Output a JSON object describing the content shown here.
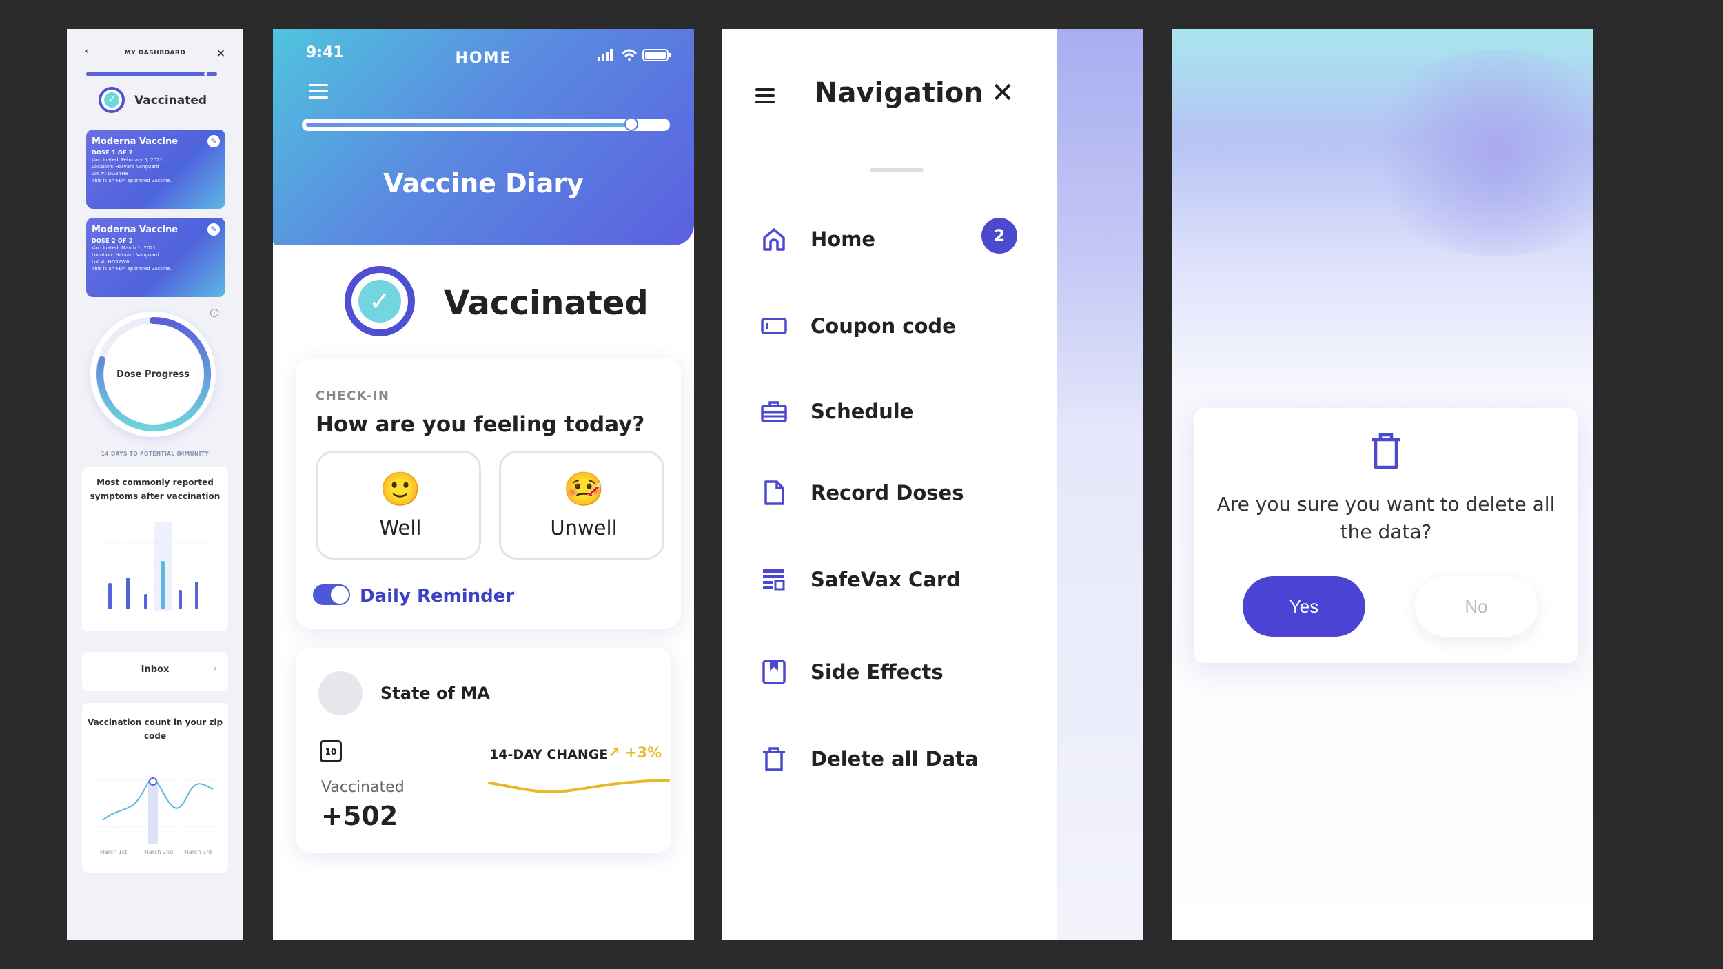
{
  "dashboard": {
    "title": "MY DASHBOARD",
    "back": "‹",
    "close": "✕",
    "status": "Vaccinated",
    "check": "✓",
    "cards": [
      {
        "name": "Moderna Vaccine",
        "dose": "DOSE 1 OF 2",
        "vaccinated": "Vaccinated: February 5, 2021",
        "location": "Location: Harvard Vanguard",
        "lot": "Lot #: DG34H8",
        "note": "This is an FDA approved vaccine.",
        "edit": "✎"
      },
      {
        "name": "Moderna Vaccine",
        "dose": "DOSE 2 OF 2",
        "vaccinated": "Vaccinated: March 1, 2021",
        "location": "Location: Harvard Vanguard",
        "lot": "Lot #: HD52W6",
        "note": "This is an FDA approved vaccine.",
        "edit": "✎"
      }
    ],
    "dose_progress_label": "Dose Progress",
    "info": "i",
    "immunity": "14 DAYS TO POTENTIAL IMMUNITY",
    "symptoms_title": "Most commonly reported symptoms after vaccination",
    "inbox": "Inbox",
    "inbox_chevron": "›",
    "vcount_title": "Vaccination count in your zip code",
    "vcount_x": [
      "March 1st",
      "March 2nd",
      "March 3rd"
    ]
  },
  "home": {
    "time": "9:41",
    "title": "HOME",
    "progress": 0.9,
    "diary": "Vaccine Diary",
    "status": "Vaccinated",
    "check": "✓",
    "checkin_label": "CHECK-IN",
    "question": "How are you feeling today?",
    "moods": [
      {
        "emoji": "🙂",
        "label": "Well"
      },
      {
        "emoji": "🤒",
        "label": "Unwell"
      }
    ],
    "reminder": "Daily Reminder",
    "state": "State of MA",
    "calendar_day": "10",
    "vaccinated_label": "Vaccinated",
    "vaccinated_value": "+502",
    "change_label": "14-DAY CHANGE",
    "change_value": "↗ +3%"
  },
  "navigation": {
    "title": "Navigation",
    "close": "✕",
    "badge": "2",
    "items": [
      {
        "label": "Home",
        "icon": "home-icon"
      },
      {
        "label": "Coupon code",
        "icon": "ticket-icon"
      },
      {
        "label": "Schedule",
        "icon": "briefcase-icon"
      },
      {
        "label": "Record Doses",
        "icon": "document-icon"
      },
      {
        "label": "SafeVax Card",
        "icon": "card-icon"
      },
      {
        "label": "Side Effects",
        "icon": "bookmark-icon"
      },
      {
        "label": "Delete all Data",
        "icon": "trash-icon"
      }
    ]
  },
  "dialog": {
    "question": "Are you sure you want to delete all the data?",
    "yes": "Yes",
    "no": "No"
  },
  "colors": {
    "primary": "#4b49cf",
    "accent_teal": "#72d5df",
    "chart_yellow": "#e8b92b"
  }
}
